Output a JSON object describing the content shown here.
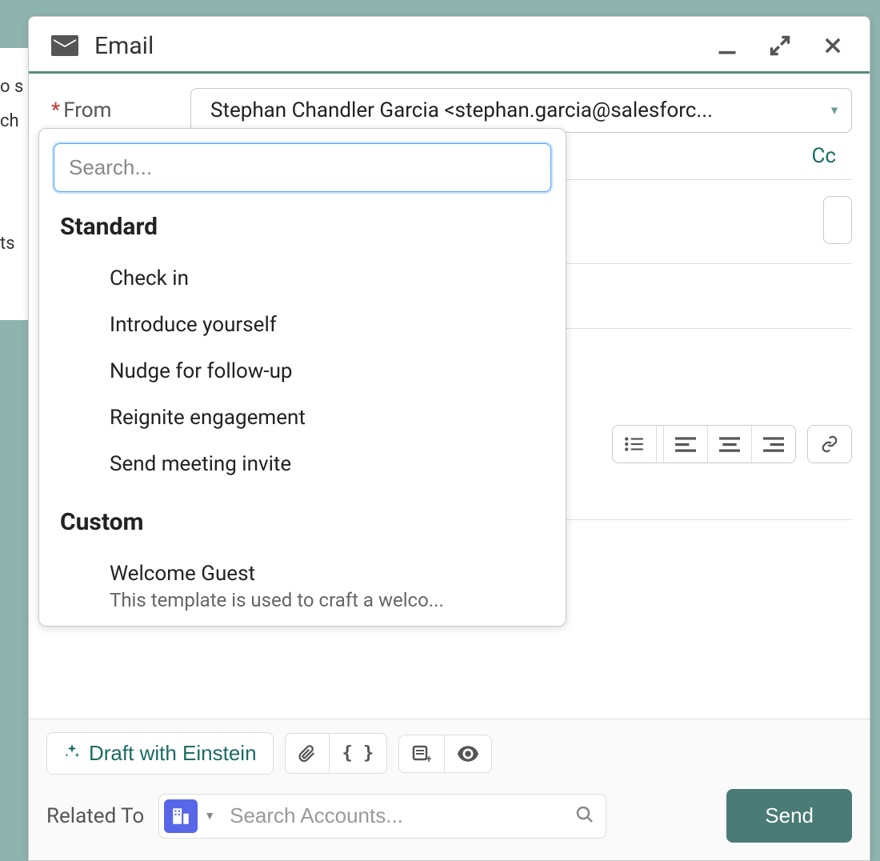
{
  "background": {
    "line1": "o s",
    "line2": "ch",
    "line3": "ts"
  },
  "header": {
    "title": "Email"
  },
  "fields": {
    "from_label": "From",
    "from_value": "Stephan Chandler Garcia <stephan.garcia@salesforc...",
    "cc_label": "Cc"
  },
  "templates": {
    "search_placeholder": "Search...",
    "standard_heading": "Standard",
    "standard_items": [
      "Check in",
      "Introduce yourself",
      "Nudge for follow-up",
      "Reignite engagement",
      "Send meeting invite"
    ],
    "custom_heading": "Custom",
    "custom_items": [
      {
        "title": "Welcome Guest",
        "desc": "This template is used to craft a welco..."
      }
    ]
  },
  "footer": {
    "einstein_label": "Draft with Einstein",
    "related_to_label": "Related To",
    "related_placeholder": "Search Accounts...",
    "send_label": "Send"
  },
  "toolbar_icons": {
    "bulleted": "bulleted-list-icon",
    "align_left": "align-left-icon",
    "align_center": "align-center-icon",
    "align_right": "align-right-icon",
    "link": "link-icon"
  }
}
